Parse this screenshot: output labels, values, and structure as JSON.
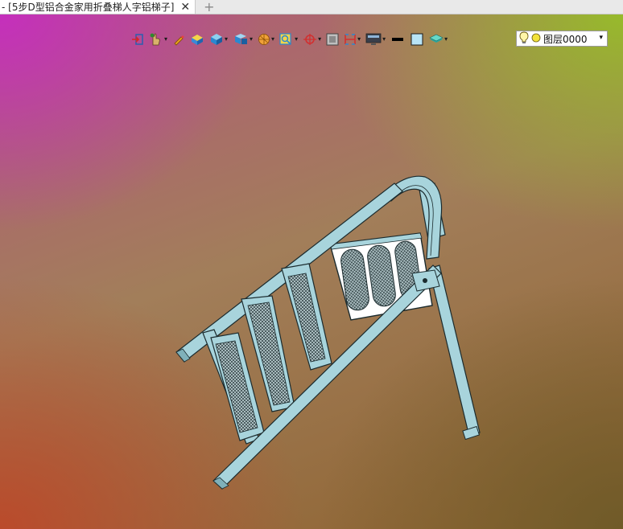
{
  "tab": {
    "title": "- [5步D型铝合金家用折叠梯人字铝梯子]",
    "close_glyph": "✕",
    "new_tab_glyph": "+"
  },
  "toolbar": {
    "caret": "▾",
    "items": [
      {
        "icon": "import-icon"
      },
      {
        "icon": "hand-pointer-icon"
      },
      {
        "icon": "pencil-icon"
      },
      {
        "icon": "solid-shaded-icon"
      },
      {
        "icon": "view-cube-icon"
      },
      {
        "icon": "standard-views-icon"
      },
      {
        "icon": "render-style-icon"
      },
      {
        "icon": "zoom-icon"
      },
      {
        "icon": "section-plane-icon"
      },
      {
        "icon": "fit-view-icon"
      },
      {
        "icon": "measure-icon"
      },
      {
        "icon": "display-screen-icon"
      },
      {
        "icon": "line-color-icon"
      },
      {
        "icon": "fill-color-icon"
      },
      {
        "icon": "layers-icon"
      }
    ],
    "layer": {
      "icon": "light-bulb-icon",
      "status_icon": "layer-on-icon",
      "value": "图层0000",
      "caret": "▾"
    }
  },
  "colors": {
    "tab_bg": "#ffffff",
    "model_fill": "#a8d4dc",
    "model_stroke": "#1b2b2e",
    "panel_fill": "#ffffff"
  }
}
